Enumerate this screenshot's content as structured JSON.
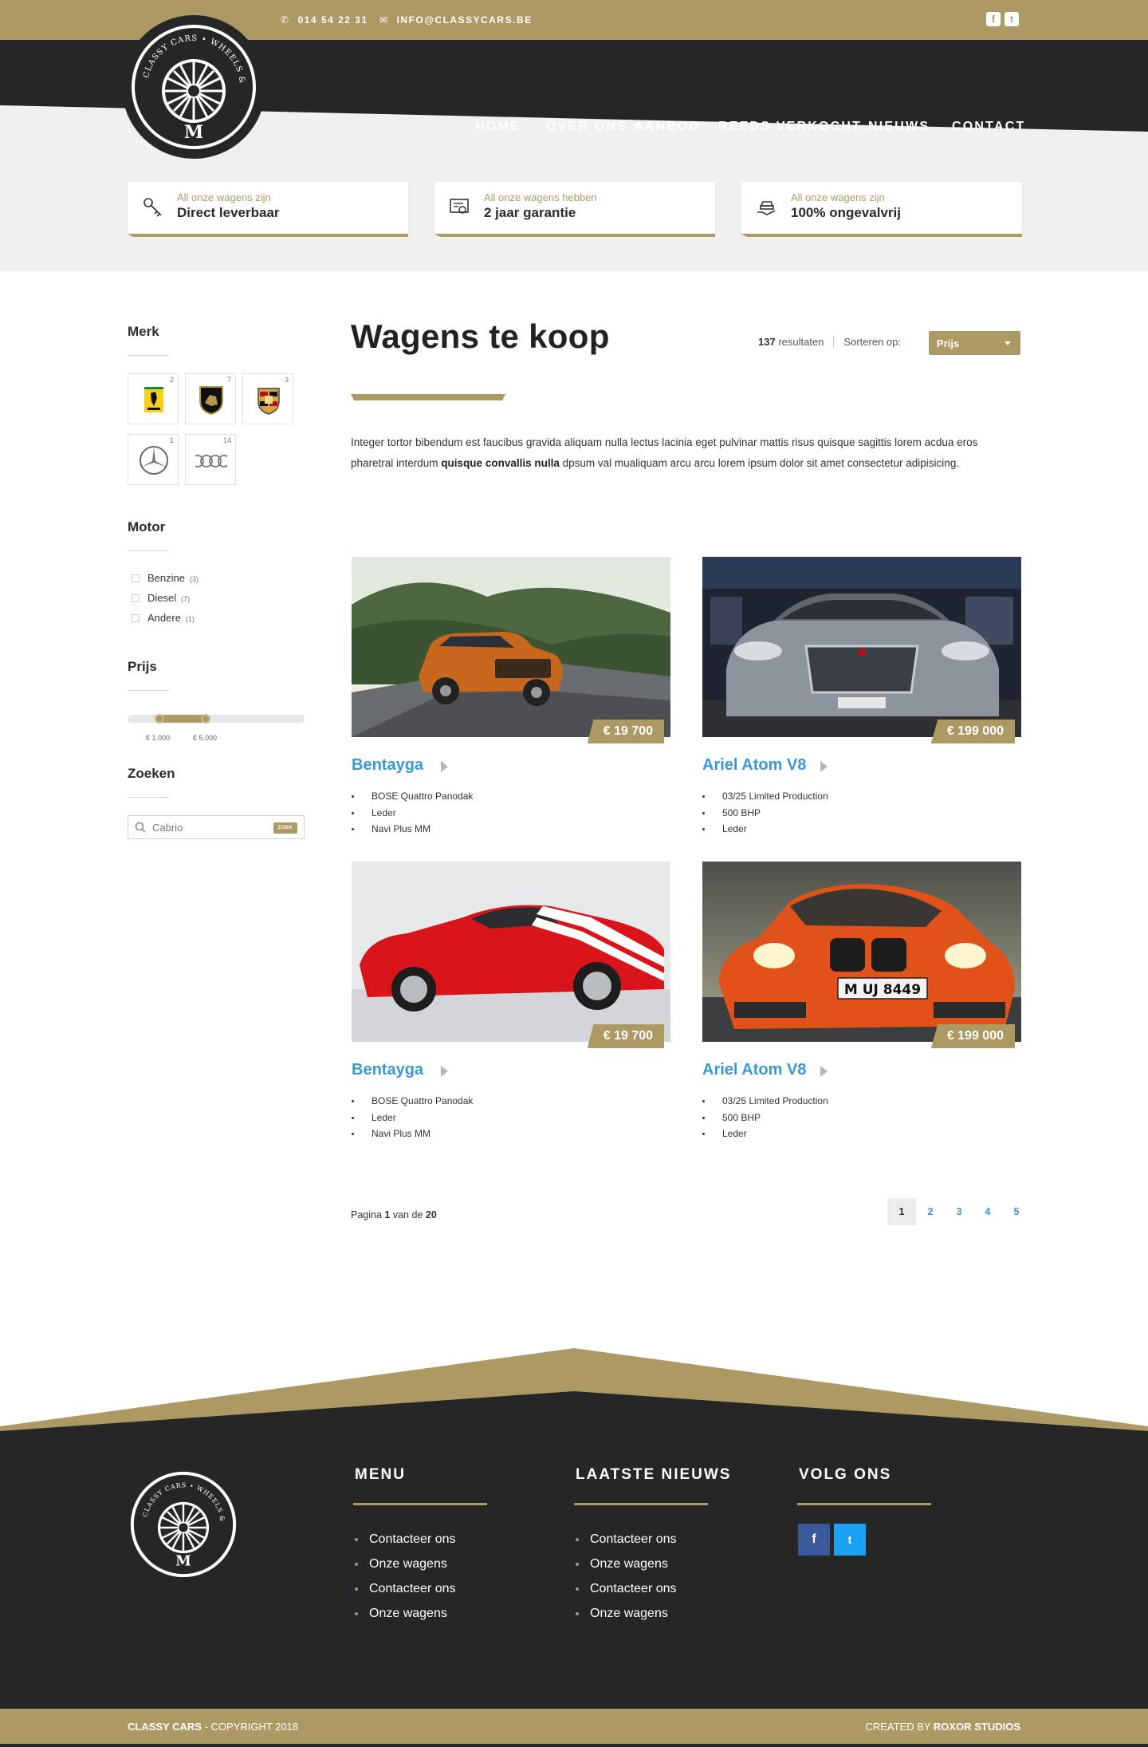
{
  "colors": {
    "accent": "#ad9964",
    "dark": "#262626",
    "link": "#3a98d4",
    "light_bg": "#f0f0f0"
  },
  "topbar": {
    "phone": "014 54 22 31",
    "email": "INFO@CLASSYCARS.BE",
    "phone_icon": "phone-icon",
    "email_icon": "envelope-icon",
    "social": [
      {
        "name": "facebook-icon",
        "glyph": "f"
      },
      {
        "name": "twitter-icon",
        "glyph": "t"
      }
    ]
  },
  "logo": {
    "ring_text": "CLASSY CARS • WHEELS & MORE",
    "letter": "M"
  },
  "nav": [
    {
      "label": "HOME",
      "active": true
    },
    {
      "label": "OVER ONS"
    },
    {
      "label": "AANBOD"
    },
    {
      "label": "REEDS VERKOCHT"
    },
    {
      "label": "NIEUWS"
    },
    {
      "label": "CONTACT"
    }
  ],
  "features": [
    {
      "small": "All onze wagens zijn",
      "big": "Direct leverbaar",
      "icon": "keys-icon"
    },
    {
      "small": "All onze wagens hebben",
      "big": "2 jaar garantie",
      "icon": "certificate-icon"
    },
    {
      "small": "All onze wagens zijn",
      "big": "100% ongevalvrij",
      "icon": "hand-car-icon"
    }
  ],
  "sidebar": {
    "merk": {
      "title": "Merk",
      "brands": [
        {
          "name": "ferrari",
          "count": "2"
        },
        {
          "name": "lamborghini",
          "count": "7"
        },
        {
          "name": "porsche",
          "count": "3"
        },
        {
          "name": "mercedes",
          "count": "1"
        },
        {
          "name": "audi",
          "count": "14"
        }
      ]
    },
    "motor": {
      "title": "Motor",
      "options": [
        {
          "label": "Benzine",
          "count": "(3)"
        },
        {
          "label": "Diesel",
          "count": "(7)"
        },
        {
          "label": "Andere",
          "count": "(1)"
        }
      ]
    },
    "prijs": {
      "title": "Prijs",
      "min_label": "€ 1.000",
      "max_label": "€ 5.000",
      "range_fraction": [
        0.18,
        0.44
      ]
    },
    "zoeken": {
      "title": "Zoeken",
      "placeholder": "Cabrio",
      "button": "ZOEK"
    }
  },
  "main": {
    "title": "Wagens te koop",
    "results_count": "137",
    "results_label": "resultaten",
    "sort_label": "Sorteren op:",
    "sort_value": "Prijs",
    "intro_part1": "Integer tortor bibendum est faucibus gravida aliquam nulla lectus lacinia eget pulvinar mattis risus quisque sagittis lorem acdua eros pharetral interdum ",
    "intro_bold": "quisque convallis nulla",
    "intro_part2": " dpsum val mualiquam arcu arcu lorem ipsum dolor sit amet consectetur adipisicing."
  },
  "cars": [
    {
      "name": "Bentayga",
      "price": "€ 19 700",
      "features": [
        "BOSE Quattro Panodak",
        "Leder",
        "Navi Plus MM"
      ],
      "color": "#c8671e",
      "scene": "mountain"
    },
    {
      "name": "Ariel Atom V8",
      "price": "€ 199 000",
      "features": [
        "03/25 Limited Production",
        "500 BHP",
        "Leder"
      ],
      "color": "#8d949e",
      "scene": "showroom"
    },
    {
      "name": "Bentayga",
      "price": "€ 19 700",
      "features": [
        "BOSE Quattro Panodak",
        "Leder",
        "Navi Plus MM"
      ],
      "color": "#d9141b",
      "scene": "studio"
    },
    {
      "name": "Ariel Atom V8",
      "price": "€ 199 000",
      "features": [
        "03/25 Limited Production",
        "500 BHP",
        "Leder"
      ],
      "color": "#e0521a",
      "scene": "road",
      "plate": "M UJ 8449"
    }
  ],
  "pagination": {
    "prefix": "Pagina",
    "current": "1",
    "middle": "van de",
    "total": "20",
    "pages": [
      "1",
      "2",
      "3",
      "4",
      "5"
    ]
  },
  "footer": {
    "menu_title": "MENU",
    "menu_items": [
      "Contacteer ons",
      "Onze wagens",
      "Contacteer ons",
      "Onze wagens"
    ],
    "news_title": "LAATSTE NIEUWS",
    "news_items": [
      "Contacteer ons",
      "Onze wagens",
      "Contacteer ons",
      "Onze wagens"
    ],
    "follow_title": "VOLG ONS",
    "facebook": "f",
    "twitter": "t",
    "brand": "CLASSY CARS",
    "copyright": " - COPYRIGHT 2018",
    "created_prefix": "CREATED BY ",
    "created_by": "ROXOR STUDIOS"
  }
}
